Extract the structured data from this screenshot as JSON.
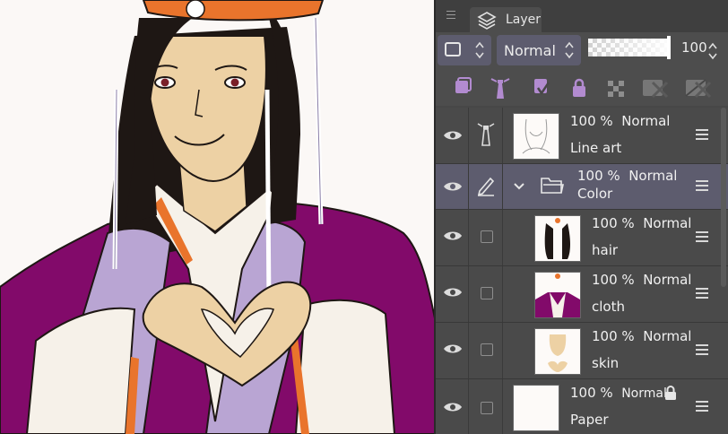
{
  "panel": {
    "tab_label": "Layer",
    "blend_mode": "Normal",
    "opacity_value": "100",
    "opacity_fraction": 1.0
  },
  "layers": [
    {
      "id": "lineart",
      "percent": "100 %",
      "mode": "Normal",
      "name": "Line art",
      "type": "layer",
      "locked": false,
      "active": false
    },
    {
      "id": "color",
      "percent": "100 %",
      "mode": "Normal",
      "name": "Color",
      "type": "folder",
      "locked": false,
      "active": true
    },
    {
      "id": "hair",
      "percent": "100 %",
      "mode": "Normal",
      "name": "hair",
      "type": "layer",
      "locked": false,
      "active": false
    },
    {
      "id": "cloth",
      "percent": "100 %",
      "mode": "Normal",
      "name": "cloth",
      "type": "layer",
      "locked": false,
      "active": false
    },
    {
      "id": "skin",
      "percent": "100 %",
      "mode": "Normal",
      "name": "skin",
      "type": "layer",
      "locked": false,
      "active": false
    },
    {
      "id": "paper",
      "percent": "100 %",
      "mode": "Normal",
      "name": "Paper",
      "type": "paper",
      "locked": true,
      "active": false
    }
  ],
  "colors": {
    "panel_bg": "#474747",
    "active_row": "#5d5c6e",
    "canvas_bg": "#fbf8f6",
    "robe_purple": "#820a6a",
    "lavender": "#b9a5d3",
    "orange": "#e9742c",
    "skin": "#edd1a4",
    "hair": "#1e1714"
  },
  "icons": [
    "layers-icon",
    "blend-mode-icon",
    "new-raster-layer-icon",
    "reference-layer-icon",
    "clip-to-lower-layer-icon",
    "lock-layer-icon",
    "lock-transparent-pixels-icon",
    "mask-icon",
    "delete-mask-icon",
    "eye-icon",
    "lighthouse-icon",
    "pen-icon",
    "folder-icon",
    "chevron-down-icon",
    "menu-icon",
    "lock-icon"
  ]
}
